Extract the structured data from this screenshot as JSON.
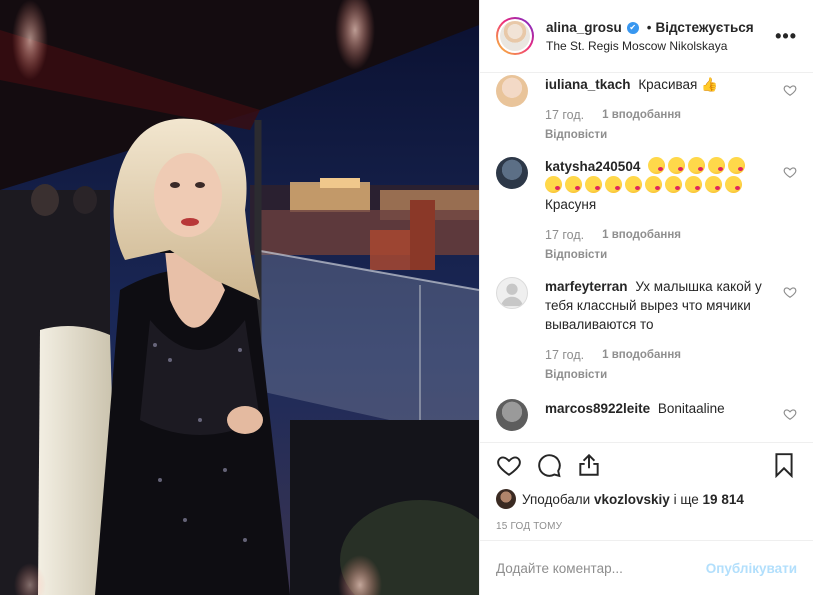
{
  "header": {
    "username": "alina_grosu",
    "verified_mark": "✔",
    "separator": "•",
    "follow_state": "Відстежується",
    "location": "The St. Regis Moscow Nikolskaya",
    "more_icon": "more-dots-icon",
    "more_label": "•••"
  },
  "comments": [
    {
      "user": "iuliana_tkach",
      "text": "Красивая 👍",
      "time": "17 год.",
      "likes": "1 вподобання",
      "reply": "Відповісти",
      "avatar_colors": [
        "#f3d9c6",
        "#e9c49a"
      ]
    },
    {
      "user": "katysha240504",
      "text": "Красуня",
      "emoji_count": 15,
      "emoji_icon": "kiss-face-emoji",
      "time": "17 год.",
      "likes": "1 вподобання",
      "reply": "Відповісти",
      "avatar_colors": [
        "#5c6f86",
        "#2d3848"
      ]
    },
    {
      "user": "marfeyterran",
      "text": "Ух малышка какой у тебя классный вырез что мячики вываливаются то",
      "time": "17 год.",
      "likes": "1 вподобання",
      "reply": "Відповісти",
      "avatar_colors": [
        "#dbdbdb",
        "#c7c7c7"
      ]
    },
    {
      "user": "marcos8922leite",
      "text": "Bonitaaline",
      "avatar_colors": [
        "#9a9a9a",
        "#5d5d5d"
      ]
    }
  ],
  "actions": {
    "like_icon": "heart-outline-icon",
    "comment_icon": "comment-bubble-icon",
    "share_icon": "share-upload-icon",
    "save_icon": "bookmark-icon"
  },
  "likes_summary": {
    "prefix": "Уподобали",
    "user": "vkozlovskiy",
    "middle": "і ще",
    "count": "19 814"
  },
  "time_ago": "15 год тому",
  "add_comment": {
    "placeholder": "Додайте коментар...",
    "publish_label": "Опублікувати"
  },
  "colors": {
    "accent_blue": "#3897f0",
    "publish_disabled": "#b2dffc",
    "muted": "#8e8e8e",
    "text": "#262626"
  }
}
